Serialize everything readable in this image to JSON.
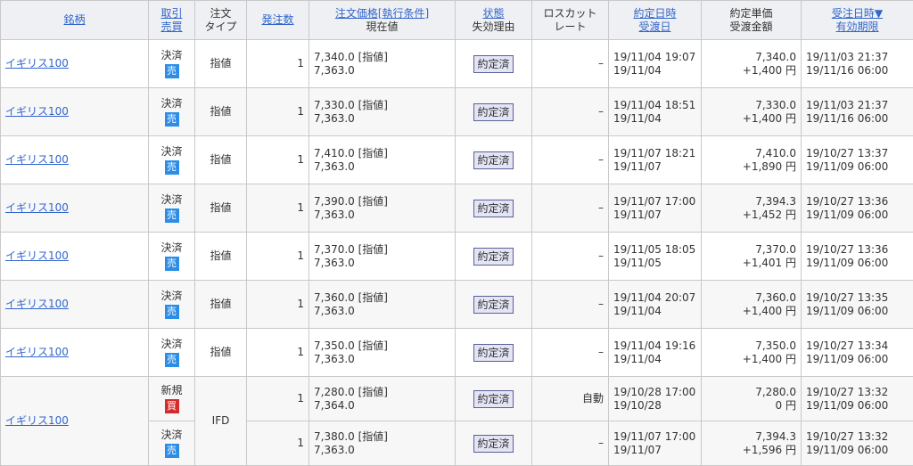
{
  "headers": {
    "meigara": "銘柄",
    "torihiki": "取引",
    "baibai": "売買",
    "chumon": "注文",
    "type": "タイプ",
    "hatchusu": "発注数",
    "kakaku": "注文価格[執行条件]",
    "genzai": "現在値",
    "jotai": "状態",
    "shikkou": "失効理由",
    "losscut1": "ロスカット",
    "losscut2": "レート",
    "yakujou_dt": "約定日時",
    "ukewatashi": "受渡日",
    "tanka": "約定単価",
    "kingaku": "受渡金額",
    "juchu": "受注日時▼",
    "kigen": "有効期限"
  },
  "rows": [
    {
      "name": "イギリス100",
      "kind": "決済",
      "side": "売",
      "type": "指値",
      "qty": "1",
      "price": "7,340.0 [指値]",
      "current": "7,363.0",
      "status": "約定済",
      "losscut": "–",
      "exec_dt": "19/11/04 19:07",
      "settle_date": "19/11/04",
      "unit": "7,340.0",
      "amount": "+1,400 円",
      "recv": "19/11/03 21:37",
      "expire": "19/11/16 06:00"
    },
    {
      "name": "イギリス100",
      "kind": "決済",
      "side": "売",
      "type": "指値",
      "qty": "1",
      "price": "7,330.0 [指値]",
      "current": "7,363.0",
      "status": "約定済",
      "losscut": "–",
      "exec_dt": "19/11/04 18:51",
      "settle_date": "19/11/04",
      "unit": "7,330.0",
      "amount": "+1,400 円",
      "recv": "19/11/03 21:37",
      "expire": "19/11/16 06:00"
    },
    {
      "name": "イギリス100",
      "kind": "決済",
      "side": "売",
      "type": "指値",
      "qty": "1",
      "price": "7,410.0 [指値]",
      "current": "7,363.0",
      "status": "約定済",
      "losscut": "–",
      "exec_dt": "19/11/07 18:21",
      "settle_date": "19/11/07",
      "unit": "7,410.0",
      "amount": "+1,890 円",
      "recv": "19/10/27 13:37",
      "expire": "19/11/09 06:00"
    },
    {
      "name": "イギリス100",
      "kind": "決済",
      "side": "売",
      "type": "指値",
      "qty": "1",
      "price": "7,390.0 [指値]",
      "current": "7,363.0",
      "status": "約定済",
      "losscut": "–",
      "exec_dt": "19/11/07 17:00",
      "settle_date": "19/11/07",
      "unit": "7,394.3",
      "amount": "+1,452 円",
      "recv": "19/10/27 13:36",
      "expire": "19/11/09 06:00"
    },
    {
      "name": "イギリス100",
      "kind": "決済",
      "side": "売",
      "type": "指値",
      "qty": "1",
      "price": "7,370.0 [指値]",
      "current": "7,363.0",
      "status": "約定済",
      "losscut": "–",
      "exec_dt": "19/11/05 18:05",
      "settle_date": "19/11/05",
      "unit": "7,370.0",
      "amount": "+1,401 円",
      "recv": "19/10/27 13:36",
      "expire": "19/11/09 06:00"
    },
    {
      "name": "イギリス100",
      "kind": "決済",
      "side": "売",
      "type": "指値",
      "qty": "1",
      "price": "7,360.0 [指値]",
      "current": "7,363.0",
      "status": "約定済",
      "losscut": "–",
      "exec_dt": "19/11/04 20:07",
      "settle_date": "19/11/04",
      "unit": "7,360.0",
      "amount": "+1,400 円",
      "recv": "19/10/27 13:35",
      "expire": "19/11/09 06:00"
    },
    {
      "name": "イギリス100",
      "kind": "決済",
      "side": "売",
      "type": "指値",
      "qty": "1",
      "price": "7,350.0 [指値]",
      "current": "7,363.0",
      "status": "約定済",
      "losscut": "–",
      "exec_dt": "19/11/04 19:16",
      "settle_date": "19/11/04",
      "unit": "7,350.0",
      "amount": "+1,400 円",
      "recv": "19/10/27 13:34",
      "expire": "19/11/09 06:00"
    }
  ],
  "ifd": {
    "name": "イギリス100",
    "type": "IFD",
    "first": {
      "kind": "新規",
      "side": "買",
      "qty": "1",
      "price": "7,280.0 [指値]",
      "current": "7,364.0",
      "status": "約定済",
      "losscut": "自動",
      "exec_dt": "19/10/28 17:00",
      "settle_date": "19/10/28",
      "unit": "7,280.0",
      "amount": "0 円",
      "recv": "19/10/27 13:32",
      "expire": "19/11/09 06:00"
    },
    "second": {
      "kind": "決済",
      "side": "売",
      "qty": "1",
      "price": "7,380.0 [指値]",
      "current": "7,363.0",
      "status": "約定済",
      "losscut": "–",
      "exec_dt": "19/11/07 17:00",
      "settle_date": "19/11/07",
      "unit": "7,394.3",
      "amount": "+1,596 円",
      "recv": "19/10/27 13:32",
      "expire": "19/11/09 06:00"
    }
  }
}
